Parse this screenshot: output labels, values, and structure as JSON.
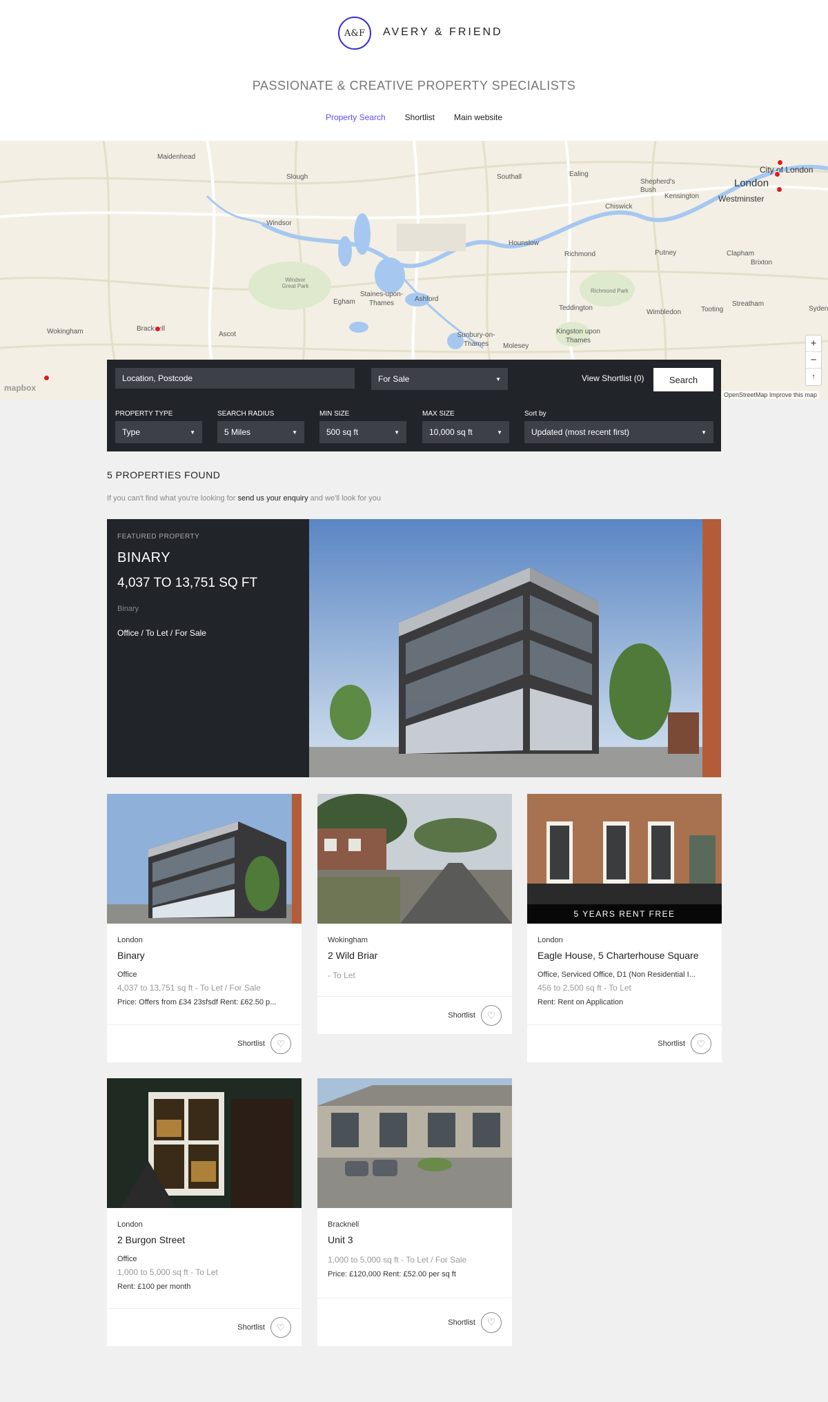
{
  "header": {
    "logo_mark": "A&F",
    "brand": "AVERY & FRIEND",
    "tagline": "PASSIONATE & CREATIVE PROPERTY SPECIALISTS",
    "nav": [
      "Property Search",
      "Shortlist",
      "Main website"
    ]
  },
  "map": {
    "places": [
      "Maidenhead",
      "Slough",
      "Southall",
      "Ealing",
      "Shepherd's Bush",
      "Kensington",
      "City of London",
      "London",
      "Westminster",
      "Chiswick",
      "Windsor",
      "Hounslow",
      "Richmond",
      "Putney",
      "Clapham",
      "Brixton",
      "Windsor Great Park",
      "Staines-upon-Thames",
      "Egham",
      "Ashford",
      "Richmond Park",
      "Teddington",
      "Wimbledon",
      "Tooting",
      "Streatham",
      "Syden",
      "Wokingham",
      "Bracknell",
      "Ascot",
      "Kingston upon Thames",
      "Sunbury-on-Thames",
      "Molesey"
    ],
    "zoom_in": "+",
    "zoom_out": "−",
    "compass": "↑",
    "logo": "mapbox",
    "attribution": "OpenStreetMap  Improve this map",
    "colors": {
      "land": "#f3efe4",
      "water": "#a6c8f0",
      "pin": "#e01a1a"
    }
  },
  "search": {
    "location_placeholder": "Location, Postcode",
    "listing": "For Sale",
    "view_shortlist": "View Shortlist (0)",
    "search_button": "Search",
    "filters": [
      {
        "label": "PROPERTY TYPE",
        "value": "Type"
      },
      {
        "label": "SEARCH RADIUS",
        "value": "5 Miles"
      },
      {
        "label": "MIN SIZE",
        "value": "500 sq ft"
      },
      {
        "label": "MAX SIZE",
        "value": "10,000 sq ft"
      },
      {
        "label": "Sort by",
        "value": "Updated (most recent first)"
      }
    ]
  },
  "results": {
    "count": "5 PROPERTIES FOUND",
    "enquiry_pre": "If you can't find what you're looking for ",
    "enquiry_link": "send us your enquiry",
    "enquiry_post": " and we'll look for you"
  },
  "featured": {
    "kicker": "FEATURED PROPERTY",
    "title": "BINARY",
    "size": "4,037 TO 13,751 SQ FT",
    "location": "Binary",
    "types": "Office / To Let / For Sale"
  },
  "properties": [
    {
      "location": "London",
      "title": "Binary",
      "type": "Office",
      "size": "4,037 to 13,751 sq ft - To Let / For Sale",
      "price": "Price: Offers from £34 23sfsdf Rent: £62.50 p...",
      "shortlist": "Shortlist",
      "badge": ""
    },
    {
      "location": "Wokingham",
      "title": "2 Wild Briar",
      "type": "",
      "size": " - To Let",
      "price": "",
      "shortlist": "Shortlist",
      "badge": ""
    },
    {
      "location": "London",
      "title": "Eagle House, 5 Charterhouse Square",
      "type": "Office, Serviced Office, D1 (Non Residential I...",
      "size": "456 to 2,500 sq ft - To Let",
      "price": "Rent: Rent on Application",
      "shortlist": "Shortlist",
      "badge": "5 YEARS RENT FREE"
    },
    {
      "location": "London",
      "title": "2 Burgon Street",
      "type": "Office",
      "size": "1,000 to 5,000 sq ft - To Let",
      "price": "Rent: £100 per month",
      "shortlist": "Shortlist",
      "badge": ""
    },
    {
      "location": "Bracknell",
      "title": "Unit 3",
      "type": "",
      "size": "1,000 to 5,000 sq ft - To Let / For Sale",
      "price": "Price: £120,000 Rent: £52.00 per sq ft",
      "shortlist": "Shortlist",
      "badge": ""
    }
  ]
}
